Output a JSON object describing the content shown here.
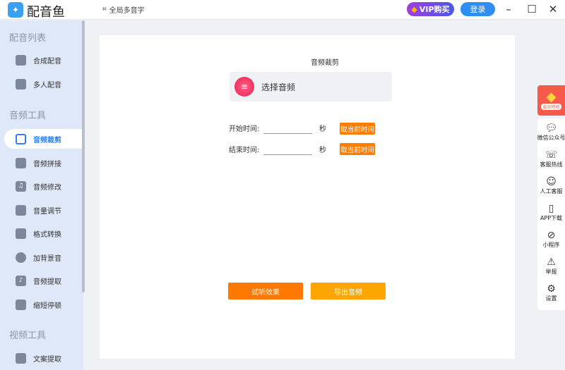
{
  "app": {
    "name": "配音鱼",
    "global_polyphone": "全局多音字",
    "vip": "VIP购买",
    "login": "登录"
  },
  "sidebar": {
    "sections": [
      {
        "title": "配音列表",
        "items": [
          {
            "label": "合成配音"
          },
          {
            "label": "多人配音"
          }
        ]
      },
      {
        "title": "音频工具",
        "items": [
          {
            "label": "音频裁剪"
          },
          {
            "label": "音频拼接"
          },
          {
            "label": "音频修改"
          },
          {
            "label": "音量调节"
          },
          {
            "label": "格式转换"
          },
          {
            "label": "加背景音"
          },
          {
            "label": "音频提取"
          },
          {
            "label": "缩短停顿"
          }
        ]
      },
      {
        "title": "视频工具",
        "items": [
          {
            "label": "文案提取"
          }
        ]
      }
    ],
    "active": "音频裁剪"
  },
  "main": {
    "title": "音频裁剪",
    "choose_audio": "选择音频",
    "start_label": "开始时间:",
    "end_label": "结束时间:",
    "start_value": "",
    "end_value": "",
    "unit": "秒",
    "get_current": "取当前时间",
    "preview": "试听效果",
    "export": "导出音频"
  },
  "right_panel": {
    "promo": "会员特权",
    "items": [
      {
        "label": "微信公众号"
      },
      {
        "label": "客服热线"
      },
      {
        "label": "人工客服"
      },
      {
        "label": "APP下载"
      },
      {
        "label": "小程序"
      },
      {
        "label": "举报"
      },
      {
        "label": "设置"
      }
    ]
  }
}
